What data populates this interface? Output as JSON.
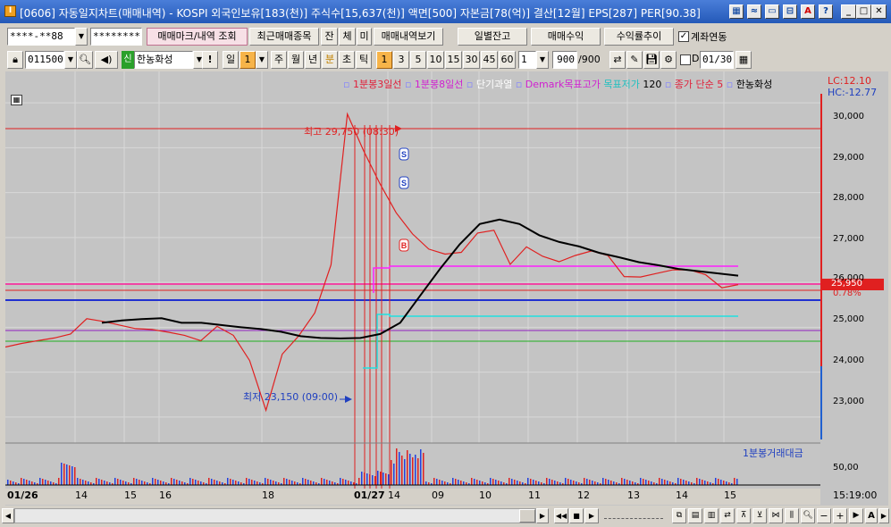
{
  "window": {
    "title": "[0606] 자동일지차트(매매내역) - KOSPI 외국인보유[183(천)] 주식수[15,637(천)] 액면[500] 자본금[78(억)] 결산[12월] EPS[287] PER[90.38]",
    "app_icon": "I",
    "toolbar_icons": [
      "window-cascade-icon",
      "graph-icon",
      "monitor-icon",
      "arrange-icon",
      "a-icon",
      "help-icon"
    ],
    "controls": [
      "minimize-icon",
      "maximize-icon",
      "close-icon"
    ]
  },
  "row1": {
    "account_value": "****-**88",
    "password_value": "********",
    "trade_mark_btn": "매매마크/내역 조회",
    "recent_trades_btn": "최근매매종목",
    "jan_btn": "잔",
    "che_btn": "체",
    "mi_btn": "미",
    "view_trades_btn": "매매내역보기",
    "daily_balance_btn": "일별잔고",
    "trade_profit_btn": "매매수익",
    "yield_trend_btn": "수익률추이",
    "account_link_label": "계좌연동",
    "account_link_checked": true
  },
  "row2": {
    "stock_code": "011500",
    "credit_badge": "신",
    "stock_name": "한농화성",
    "exclaim": "!",
    "period_day": "일",
    "period_value": "1",
    "periods": [
      "주",
      "월",
      "년",
      "분",
      "초",
      "틱"
    ],
    "minutes": [
      "1",
      "3",
      "5",
      "10",
      "15",
      "30",
      "45",
      "60"
    ],
    "selected_minute": "1",
    "count_dd": "1",
    "count": "900",
    "count_total": "/900",
    "date_checked": false,
    "date_label": "D",
    "date_value": "01/30"
  },
  "chart": {
    "legend": [
      {
        "text": "1분봉3일선",
        "color": "#e0203a"
      },
      {
        "text": "1분봉8일선",
        "color": "#d020d0"
      },
      {
        "text": "단기과열",
        "color": "#000000"
      },
      {
        "text": "Demark목표고가",
        "color": "#d020d0"
      },
      {
        "text": "목표저가",
        "color": "#20c0c0"
      },
      {
        "text": "120",
        "color": "#000000"
      },
      {
        "text": "종가 단순 5",
        "color": "#e0203a"
      },
      {
        "text": "한농화성",
        "color": "#000000"
      }
    ],
    "lc": "LC:12.10",
    "hc": "HC:-12.77",
    "high_label": "최고 29,750 (08:30)",
    "low_label": "최저 23,150 (09:00)",
    "current_price": "25,950",
    "change_pct": "0.78%",
    "y_ticks": [
      "30,000",
      "29,000",
      "28,000",
      "27,000",
      "26,000",
      "25,000",
      "24,000",
      "23,000"
    ],
    "marks": [
      "S",
      "S",
      "B"
    ],
    "volume_label": "1분봉거래대금",
    "volume_tick": "50,00",
    "x_labels": [
      "01/26",
      "14",
      "15",
      "16",
      "18",
      "01/27",
      "14",
      "09",
      "10",
      "11",
      "12",
      "13",
      "14",
      "15"
    ],
    "time_label": "15:19:00"
  },
  "chart_data": {
    "type": "line",
    "series": [
      {
        "name": "한농화성",
        "values": [
          24560,
          24640,
          24700,
          24760,
          24850,
          25190,
          25130,
          25050,
          24970,
          24950,
          24890,
          24820,
          24700,
          25020,
          24820,
          24260,
          23150,
          24400,
          24800,
          25320,
          26390,
          29750,
          28930,
          28200,
          27550,
          27080,
          26740,
          26630,
          26670,
          27100,
          27160,
          26400,
          26790,
          26580,
          26460,
          26600,
          26700,
          26600,
          26130,
          26120,
          26200,
          26280,
          26280,
          26170,
          25880,
          25950
        ]
      },
      {
        "name": "120",
        "values": [
          25100,
          25150,
          25180,
          25200,
          25100,
          25100,
          25050,
          25000,
          24960,
          24900,
          24800,
          24760,
          24750,
          24760,
          24850,
          25100,
          25700,
          26300,
          26850,
          27300,
          27400,
          27300,
          27050,
          26900,
          26800,
          26660,
          26560,
          26450,
          26380,
          26300,
          26250,
          26200,
          26150
        ]
      }
    ],
    "y_range": [
      22500,
      30500
    ]
  }
}
